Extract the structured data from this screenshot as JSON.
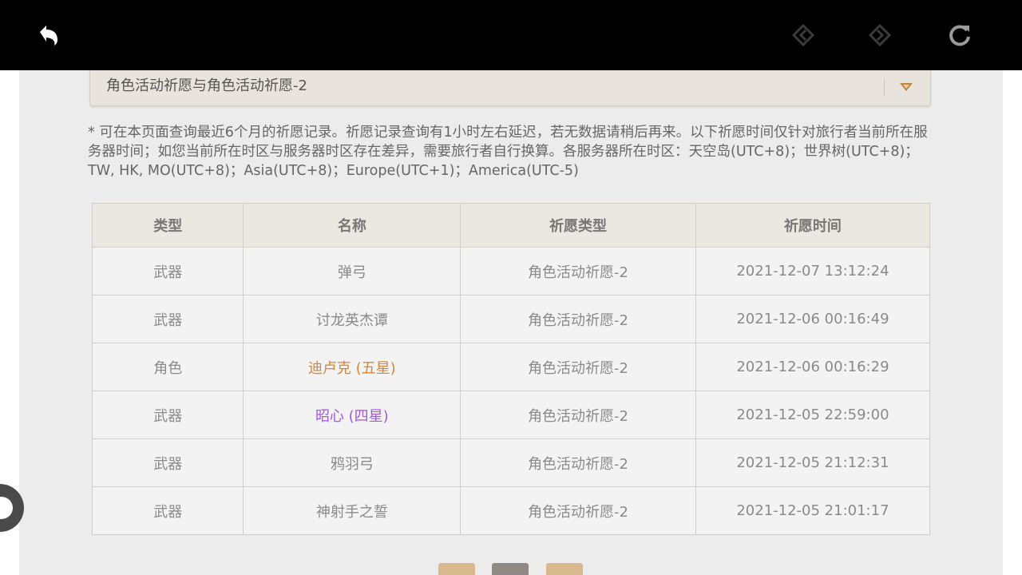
{
  "wish_select": {
    "selected": "角色活动祈愿与角色活动祈愿-2"
  },
  "notice": "* 可在本页面查询最近6个月的祈愿记录。祈愿记录查询有1小时左右延迟，若无数据请稍后再来。以下祈愿时间仅针对旅行者当前所在服务器时间；如您当前所在时区与服务器时区存在差异，需要旅行者自行换算。各服务器所在时区：天空岛(UTC+8)；世界树(UTC+8)；TW, HK, MO(UTC+8)；Asia(UTC+8)；Europe(UTC+1)；America(UTC-5)",
  "table": {
    "headers": [
      "类型",
      "名称",
      "祈愿类型",
      "祈愿时间"
    ],
    "rows": [
      {
        "type": "武器",
        "name": "弹弓",
        "wish": "角色活动祈愿-2",
        "time": "2021-12-07 13:12:24",
        "rarity": "3"
      },
      {
        "type": "武器",
        "name": "讨龙英杰谭",
        "wish": "角色活动祈愿-2",
        "time": "2021-12-06 00:16:49",
        "rarity": "3"
      },
      {
        "type": "角色",
        "name": "迪卢克 (五星)",
        "wish": "角色活动祈愿-2",
        "time": "2021-12-06 00:16:29",
        "rarity": "5"
      },
      {
        "type": "武器",
        "name": "昭心 (四星)",
        "wish": "角色活动祈愿-2",
        "time": "2021-12-05 22:59:00",
        "rarity": "4"
      },
      {
        "type": "武器",
        "name": "鸦羽弓",
        "wish": "角色活动祈愿-2",
        "time": "2021-12-05 21:12:31",
        "rarity": "3"
      },
      {
        "type": "武器",
        "name": "神射手之誓",
        "wish": "角色活动祈愿-2",
        "time": "2021-12-05 21:01:17",
        "rarity": "3"
      }
    ]
  },
  "colors": {
    "five_star": "#d98536",
    "four_star": "#a256e1",
    "pager_prev": "#d8b98e",
    "pager_current": "#8f8a84",
    "pager_next": "#d8b98e"
  },
  "icons": {
    "back": "back-arrow-icon",
    "prev": "diamond-left-icon",
    "next": "diamond-right-icon",
    "refresh": "refresh-icon",
    "dropdown": "triangle-down-icon"
  }
}
